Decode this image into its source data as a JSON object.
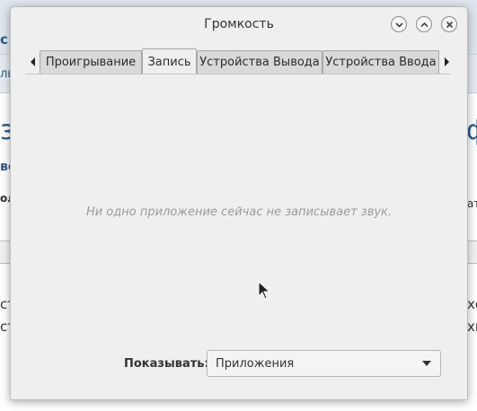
{
  "background": {
    "left_fragments": [
      "с",
      "ль",
      "зн",
      "ве",
      "оль",
      "ст",
      "ст"
    ],
    "right_fragments": [
      "ф",
      "ат",
      "хо",
      "хн"
    ]
  },
  "window": {
    "title": "Громкость",
    "buttons": [
      "minimize",
      "maximize",
      "close"
    ]
  },
  "tabs": [
    {
      "label": "Проигрывание",
      "active": false
    },
    {
      "label": "Запись",
      "active": true
    },
    {
      "label": "Устройства Вывода",
      "active": false
    },
    {
      "label": "Устройства Ввода",
      "active": false
    }
  ],
  "content": {
    "empty_message": "Ни одно приложение сейчас не записывает звук."
  },
  "footer": {
    "show_label": "Показывать:",
    "show_value": "Приложения"
  },
  "colors": {
    "background_app_accent": "#2a5a8a",
    "dialog_bg": "#efefef"
  }
}
